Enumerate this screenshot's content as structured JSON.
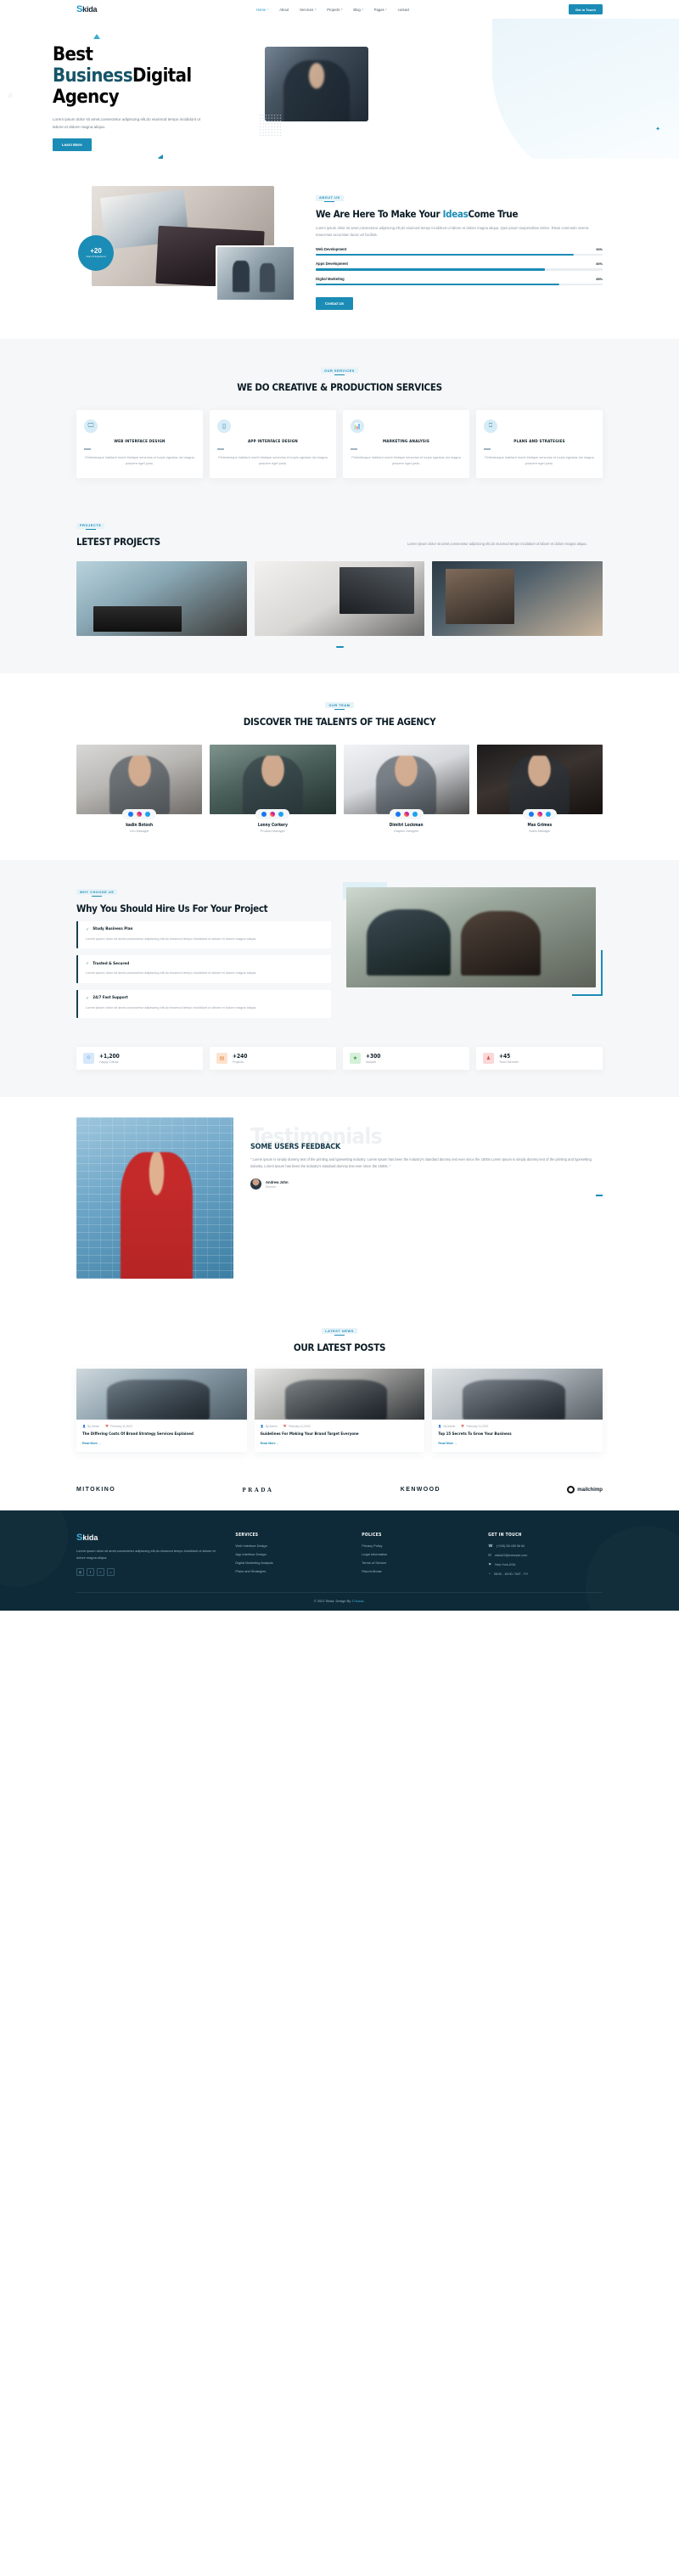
{
  "brand": {
    "prefix": "S",
    "name": "kida"
  },
  "nav": {
    "items": [
      {
        "label": "Home",
        "caret": true,
        "active": true
      },
      {
        "label": "About",
        "caret": false,
        "active": false
      },
      {
        "label": "Services",
        "caret": true,
        "active": false
      },
      {
        "label": "Projects",
        "caret": true,
        "active": false
      },
      {
        "label": "Blog",
        "caret": true,
        "active": false
      },
      {
        "label": "Pages",
        "caret": true,
        "active": false
      },
      {
        "label": "contact",
        "caret": false,
        "active": false
      }
    ],
    "cta": "Get in Touch"
  },
  "hero": {
    "line1": "Best",
    "line2_accent": "Business",
    "line2_rest": "Digital",
    "line3": "Agency",
    "desc": "Lorem ipsum dolor sit amet,consectetur adipiscing elit,do eiusmod tempo incididunt ut labore et dolore magna aliqua.",
    "button": "Learn More"
  },
  "about": {
    "eyebrow": "ABOUT US",
    "title_pre": "We Are Here To Make Your ",
    "title_accent": "Ideas",
    "title_post": "Come True",
    "desc": "Lorem ipsum dolor sit amet,consectetur adipiscing elit,do eiusmod tempo incididunt ut labore et dolore magna aliqua. Quis ipsum suspendisse ultrice. Risus commodo viverra maecenas accumsan lacus vel facilisis.",
    "badge_num": "+20",
    "badge_label": "Years Of Experience",
    "skills": [
      {
        "name": "Web Development",
        "pct": "90%",
        "value": 90
      },
      {
        "name": "Apps Development",
        "pct": "80%",
        "value": 80
      },
      {
        "name": "Digital Marketing",
        "pct": "85%",
        "value": 85
      }
    ],
    "button": "Contact Us"
  },
  "services": {
    "eyebrow": "OUR SERVICES",
    "title": "WE DO CREATIVE & PRODUCTION SERVICES",
    "cards": [
      {
        "icon": "monitor-icon",
        "glyph": "☐",
        "title": "WEB INTERFACE DESIGN",
        "text": "Pellentesque habitant morbi tristique senectus et turpis egestas dui magna posuere eget justo."
      },
      {
        "icon": "mobile-icon",
        "glyph": "▯",
        "title": "APP INTERFACE DESIGN",
        "text": "Pellentesque habitant morbi tristique senectus et turpis egestas dui magna posuere eget justo."
      },
      {
        "icon": "chart-bar-icon",
        "glyph": "█",
        "title": "MARKETING ANALYSIS",
        "text": "Pellentesque habitant morbi tristique senectus et turpis egestas dui magna posuere eget justo."
      },
      {
        "icon": "presentation-icon",
        "glyph": "⚑",
        "title": "PLANS AND STRATEGIES",
        "text": "Pellentesque habitant morbi tristique senectus et turpis egestas dui magna posuere eget justo."
      }
    ]
  },
  "projects": {
    "eyebrow": "PROJECTS",
    "title": "LETEST PROJECTS",
    "desc": "Lorem ipsum dolor sit amet,consectetur adipiscing elit,do eiusmod tempo incididunt ut labore et dolore magna aliqua."
  },
  "team": {
    "eyebrow": "OUR TEAM",
    "title": "DISCOVER THE TALENTS OF THE AGENCY",
    "members": [
      {
        "name": "kadin Botosh",
        "role": "Ceo Manager"
      },
      {
        "name": "Lonny Corkery",
        "role": "Product Manager"
      },
      {
        "name": "Dimitri Lockman",
        "role": "Graphic Designer"
      },
      {
        "name": "Max Grimes",
        "role": "Sales Manager"
      }
    ]
  },
  "why": {
    "eyebrow": "WHY CHOOSE US",
    "title": "Why You Should Hire Us For Your Project",
    "features": [
      {
        "title": "Study Business Plan",
        "text": "Lorem ipsum dolor sit amet,consectetur adipiscing elit,do eiusmod tempo incididunt ut labore et dolore magna aliqua."
      },
      {
        "title": "Trusted & Secured",
        "text": "Lorem ipsum dolor sit amet,consectetur adipiscing elit,do eiusmod tempo incididunt ut labore et dolore magna aliqua."
      },
      {
        "title": "24/7 Fast Support",
        "text": "Lorem ipsum dolor sit amet,consectetur adipiscing elit,do eiusmod tempo incididunt ut labore et dolore magna aliqua."
      }
    ]
  },
  "stats": [
    {
      "icon": "user-icon",
      "glyph": "☺",
      "num": "+1,200",
      "label": "Happy Clients"
    },
    {
      "icon": "projects-icon",
      "glyph": "☷",
      "num": "+240",
      "label": "Projects"
    },
    {
      "icon": "award-icon",
      "glyph": "★",
      "num": "+300",
      "label": "Awards"
    },
    {
      "icon": "team-icon",
      "glyph": "♠",
      "num": "+45",
      "label": "Team Member"
    }
  ],
  "testimonials": {
    "watermark": "Testimonials",
    "title": "SOME USERS FEEDBACK",
    "quote": "“ Lorem ipsum is simply dummy text of the printing and typesetting industry. Lorem Ipsum has been the industry's standard dummy text ever since the 1500s Lorem Ipsum is simply dummy text of the printing and typesetting industry. Lorem Ipsum has been the industry's standard dummy text ever since the 1500s. ”",
    "person_name": "Andrew John",
    "person_role": "Director"
  },
  "blog": {
    "eyebrow": "LATEST NEWS",
    "title": "OUR LATEST POSTS",
    "posts": [
      {
        "author": "By Admin",
        "date": "February 11,2022",
        "title": "The Differing Costs Of Brand Strategy Services Explained",
        "more": "Read More →"
      },
      {
        "author": "By Admin",
        "date": "February 11,2022",
        "title": "Guidelines For Making Your Brand Target Everyone",
        "more": "Read More →"
      },
      {
        "author": "By Admin",
        "date": "February 11,2022",
        "title": "Top 15 Secrets To Grow Your Business",
        "more": "Read More →"
      }
    ]
  },
  "brands": [
    {
      "name": "MITOKINO",
      "style": "plain"
    },
    {
      "name": "PRADA",
      "style": "serif"
    },
    {
      "name": "KENWOOD",
      "style": "plain"
    },
    {
      "name": "mailchimp",
      "style": "mc"
    }
  ],
  "footer": {
    "logo_prefix": "S",
    "logo_name": "kida",
    "desc": "Lorem ipsum dolor sit amet,consectetur adipiscing elit,do eiusmod tempo incididunt ut labore et dolore magna aliqua.",
    "socials": [
      "◎",
      "f",
      "✓",
      "○"
    ],
    "services_head": "SERVICES",
    "services": [
      "Web Interface Design",
      "App Interface Design",
      "Digital Marketing Analysis",
      "Plans and Strategies"
    ],
    "polices_head": "POLICES",
    "polices": [
      "Privacy Policy",
      "Legal Information",
      "Terms of Service",
      "Report Abuse"
    ],
    "touch_head": "GET IN TOUCH",
    "contacts": [
      {
        "icon": "phone-icon",
        "glyph": "☎",
        "text": "(+245) 56 455 56 84"
      },
      {
        "icon": "mail-icon",
        "glyph": "✉",
        "text": "skida22@exemple.com"
      },
      {
        "icon": "location-icon",
        "glyph": "⚑",
        "text": "New York,USA"
      },
      {
        "icon": "clock-icon",
        "glyph": "◔",
        "text": "08:00 - 18:00 / SAT - TH"
      }
    ],
    "copyright_pre": "© 2022 Skida. Design By ",
    "copyright_link": "17sucaL",
    "copyright_post": "."
  }
}
